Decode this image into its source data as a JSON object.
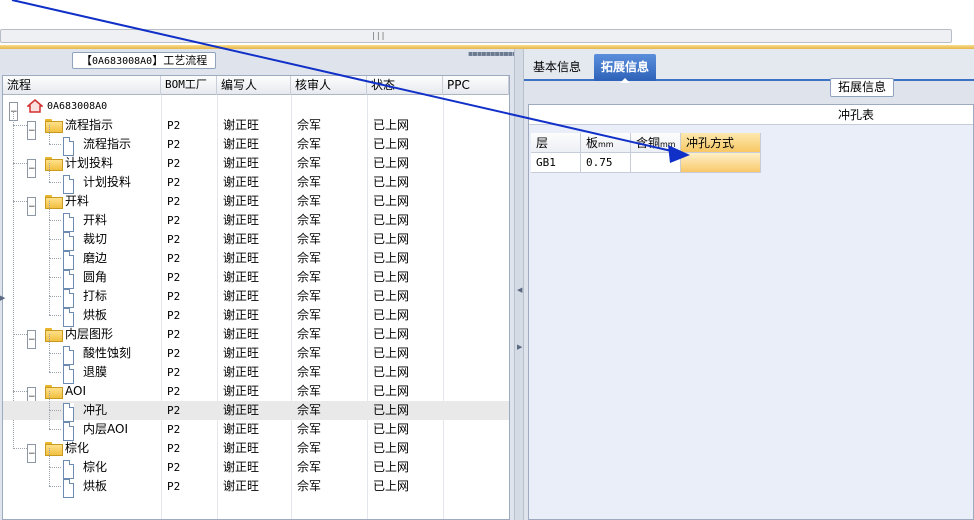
{
  "left_panel": {
    "title_prefix": "【",
    "title_code": "0A683008A0",
    "title_suffix": "】工艺流程",
    "columns": [
      "流程",
      "BOM工厂",
      "编写人",
      "核审人",
      "状态",
      "PPC"
    ],
    "root": "0A683008A0",
    "rows": [
      {
        "name": "流程指示",
        "level": 1,
        "type": "folder",
        "bom": "P2",
        "writer": "谢正旺",
        "reviewer": "佘军",
        "status": "已上网",
        "ppc": ""
      },
      {
        "name": "流程指示",
        "level": 2,
        "type": "doc",
        "bom": "P2",
        "writer": "谢正旺",
        "reviewer": "佘军",
        "status": "已上网",
        "ppc": ""
      },
      {
        "name": "计划投料",
        "level": 1,
        "type": "folder",
        "bom": "P2",
        "writer": "谢正旺",
        "reviewer": "佘军",
        "status": "已上网",
        "ppc": ""
      },
      {
        "name": "计划投料",
        "level": 2,
        "type": "doc",
        "bom": "P2",
        "writer": "谢正旺",
        "reviewer": "佘军",
        "status": "已上网",
        "ppc": ""
      },
      {
        "name": "开料",
        "level": 1,
        "type": "folder",
        "bom": "P2",
        "writer": "谢正旺",
        "reviewer": "佘军",
        "status": "已上网",
        "ppc": ""
      },
      {
        "name": "开料",
        "level": 2,
        "type": "doc",
        "bom": "P2",
        "writer": "谢正旺",
        "reviewer": "佘军",
        "status": "已上网",
        "ppc": ""
      },
      {
        "name": "裁切",
        "level": 2,
        "type": "doc",
        "bom": "P2",
        "writer": "谢正旺",
        "reviewer": "佘军",
        "status": "已上网",
        "ppc": ""
      },
      {
        "name": "磨边",
        "level": 2,
        "type": "doc",
        "bom": "P2",
        "writer": "谢正旺",
        "reviewer": "佘军",
        "status": "已上网",
        "ppc": ""
      },
      {
        "name": "圆角",
        "level": 2,
        "type": "doc",
        "bom": "P2",
        "writer": "谢正旺",
        "reviewer": "佘军",
        "status": "已上网",
        "ppc": ""
      },
      {
        "name": "打标",
        "level": 2,
        "type": "doc",
        "bom": "P2",
        "writer": "谢正旺",
        "reviewer": "佘军",
        "status": "已上网",
        "ppc": ""
      },
      {
        "name": "烘板",
        "level": 2,
        "type": "doc",
        "bom": "P2",
        "writer": "谢正旺",
        "reviewer": "佘军",
        "status": "已上网",
        "ppc": ""
      },
      {
        "name": "内层图形",
        "level": 1,
        "type": "folder",
        "bom": "P2",
        "writer": "谢正旺",
        "reviewer": "佘军",
        "status": "已上网",
        "ppc": ""
      },
      {
        "name": "酸性蚀刻",
        "level": 2,
        "type": "doc",
        "bom": "P2",
        "writer": "谢正旺",
        "reviewer": "佘军",
        "status": "已上网",
        "ppc": ""
      },
      {
        "name": "退膜",
        "level": 2,
        "type": "doc",
        "bom": "P2",
        "writer": "谢正旺",
        "reviewer": "佘军",
        "status": "已上网",
        "ppc": ""
      },
      {
        "name": "AOI",
        "level": 1,
        "type": "folder",
        "bom": "P2",
        "writer": "谢正旺",
        "reviewer": "佘军",
        "status": "已上网",
        "ppc": ""
      },
      {
        "name": "冲孔",
        "level": 2,
        "type": "doc",
        "bom": "P2",
        "writer": "谢正旺",
        "reviewer": "佘军",
        "status": "已上网",
        "ppc": "",
        "selected": true
      },
      {
        "name": "内层AOI",
        "level": 2,
        "type": "doc",
        "bom": "P2",
        "writer": "谢正旺",
        "reviewer": "佘军",
        "status": "已上网",
        "ppc": ""
      },
      {
        "name": "棕化",
        "level": 1,
        "type": "folder",
        "bom": "P2",
        "writer": "谢正旺",
        "reviewer": "佘军",
        "status": "已上网",
        "ppc": ""
      },
      {
        "name": "棕化",
        "level": 2,
        "type": "doc",
        "bom": "P2",
        "writer": "谢正旺",
        "reviewer": "佘军",
        "status": "已上网",
        "ppc": ""
      },
      {
        "name": "烘板",
        "level": 2,
        "type": "doc",
        "bom": "P2",
        "writer": "谢正旺",
        "reviewer": "佘军",
        "status": "已上网",
        "ppc": ""
      }
    ]
  },
  "right_panel": {
    "tabs": [
      {
        "label": "基本信息",
        "active": false
      },
      {
        "label": "拓展信息",
        "active": true
      }
    ],
    "section_title": "拓展信息",
    "table_title": "冲孔表",
    "table": {
      "headers": [
        {
          "text": "层",
          "unit": ""
        },
        {
          "text": "板",
          "unit": "mm"
        },
        {
          "text": "含铜",
          "unit": "mm"
        },
        {
          "text": "冲孔方式",
          "unit": ""
        }
      ],
      "rows": [
        [
          "GB1",
          "0.75",
          "",
          ""
        ]
      ]
    }
  },
  "overlay": {
    "arrow_color": "#1030c8"
  }
}
